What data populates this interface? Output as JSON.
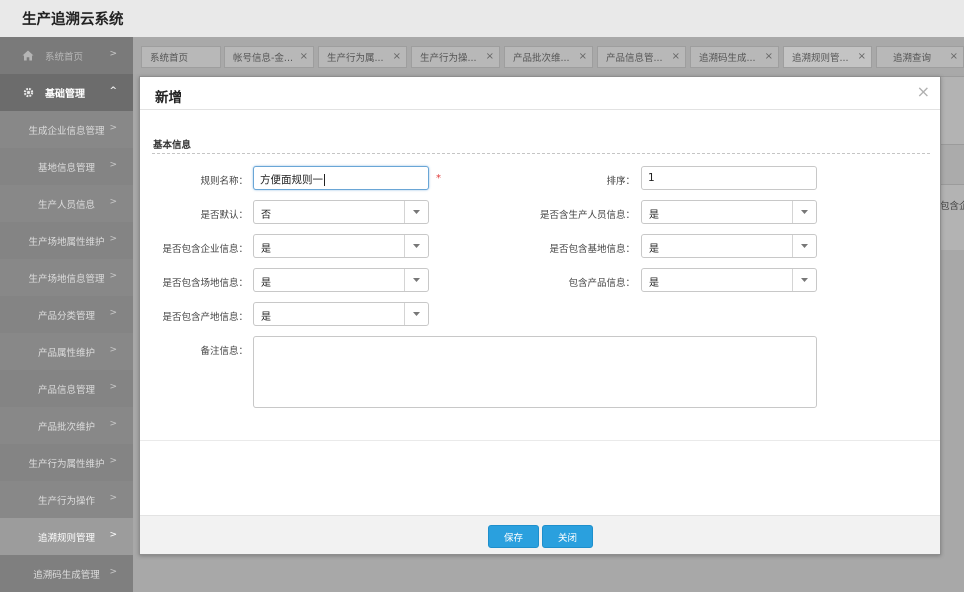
{
  "app": {
    "title": "生产追溯云系统"
  },
  "sidebar": {
    "items": [
      {
        "label": "系统首页",
        "icon": "home-icon"
      },
      {
        "label": "基础管理",
        "icon": "gear-icon"
      },
      {
        "label": "生成企业信息管理"
      },
      {
        "label": "基地信息管理"
      },
      {
        "label": "生产人员信息"
      },
      {
        "label": "生产场地属性维护"
      },
      {
        "label": "生产场地信息管理"
      },
      {
        "label": "产品分类管理"
      },
      {
        "label": "产品属性维护"
      },
      {
        "label": "产品信息管理"
      },
      {
        "label": "产品批次维护"
      },
      {
        "label": "生产行为属性维护"
      },
      {
        "label": "生产行为操作"
      },
      {
        "label": "追溯规则管理"
      },
      {
        "label": "追溯码生成管理"
      }
    ],
    "chevron": ">",
    "group_chevron": "^"
  },
  "tabs": [
    {
      "label": "系统首页"
    },
    {
      "label": "帐号信息-金..."
    },
    {
      "label": "生产行为属..."
    },
    {
      "label": "生产行为操..."
    },
    {
      "label": "产品批次维..."
    },
    {
      "label": "产品信息管..."
    },
    {
      "label": "追溯码生成..."
    },
    {
      "label": "追溯规则管..."
    },
    {
      "label": "追溯查询"
    }
  ],
  "tab_close": "×",
  "background": {
    "right_snippet": "包含企"
  },
  "modal": {
    "title": "新增",
    "close": "×",
    "section": "基本信息",
    "fields": {
      "rule_name": {
        "label": "规则名称：",
        "value": "方便面规则一",
        "required_mark": "*"
      },
      "sort": {
        "label": "排序：",
        "value": "1"
      },
      "is_default": {
        "label": "是否默认：",
        "value": "否"
      },
      "include_staff": {
        "label": "是否含生产人员信息：",
        "value": "是"
      },
      "include_enterprise": {
        "label": "是否包含企业信息：",
        "value": "是"
      },
      "include_base": {
        "label": "是否包含基地信息：",
        "value": "是"
      },
      "include_site": {
        "label": "是否包含场地信息：",
        "value": "是"
      },
      "include_product": {
        "label": "包含产品信息：",
        "value": "是"
      },
      "include_origin": {
        "label": "是否包含产地信息：",
        "value": "是"
      },
      "remark": {
        "label": "备注信息：",
        "value": ""
      }
    },
    "buttons": {
      "save": "保存",
      "close": "关闭"
    },
    "colors": {
      "primary": "#2aa0de",
      "required": "#e03a3a"
    }
  }
}
